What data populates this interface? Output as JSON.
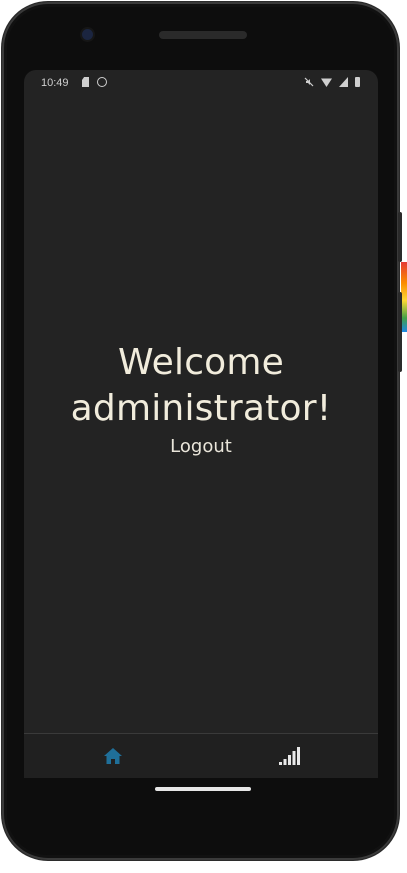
{
  "status_bar": {
    "time": "10:49",
    "left_icons": [
      "sd-card-icon",
      "sync-icon"
    ],
    "right_icons": [
      "mute-icon",
      "wifi-icon",
      "cell-signal-icon",
      "battery-icon"
    ]
  },
  "main": {
    "welcome_line1": "Welcome",
    "welcome_line2": "administrator!",
    "logout_label": "Logout"
  },
  "bottom_nav": {
    "items": [
      {
        "icon": "home-icon",
        "active": true
      },
      {
        "icon": "signal-bars-icon",
        "active": false
      }
    ]
  },
  "colors": {
    "screen_background": "#232323",
    "title_text": "#f1ecdc",
    "active_nav": "#1f6f99",
    "inactive_nav": "#e8e8e8"
  }
}
